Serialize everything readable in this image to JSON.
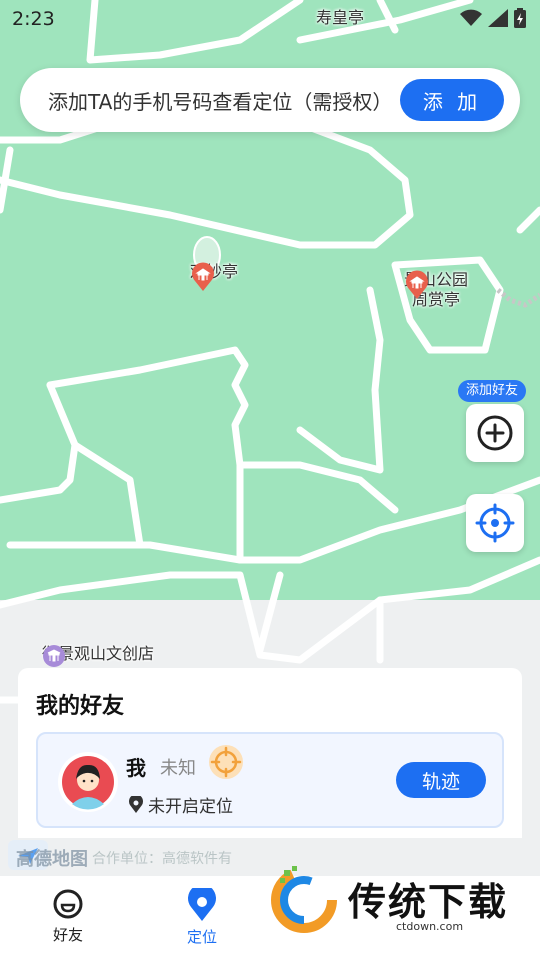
{
  "status_bar": {
    "time": "2:23"
  },
  "map": {
    "pois": [
      {
        "name": "寿皇亭"
      },
      {
        "name": "观妙亭"
      },
      {
        "name": "景山公园"
      },
      {
        "name": "周赏亭"
      },
      {
        "name": "御景观山文创店"
      }
    ],
    "attribution": {
      "brand": "高德地图",
      "partner": "合作单位：高德软件有"
    }
  },
  "banner": {
    "text": "添加TA的手机号码查看定位（需授权）",
    "button_label": "添 加"
  },
  "map_controls": {
    "add_friend_tip": "添加好友"
  },
  "friends_panel": {
    "title": "我的好友",
    "friends": [
      {
        "name": "我",
        "status": "未知",
        "location": "未开启定位",
        "track_label": "轨迹"
      }
    ]
  },
  "tabs": [
    {
      "label": "好友",
      "active": false
    },
    {
      "label": "定位",
      "active": true
    }
  ],
  "watermark": {
    "text": "传统下载",
    "url": "ctdown.com"
  },
  "colors": {
    "accent": "#1d6ff2",
    "map_green": "#9fe4bd",
    "poi_red": "#e8604c"
  }
}
